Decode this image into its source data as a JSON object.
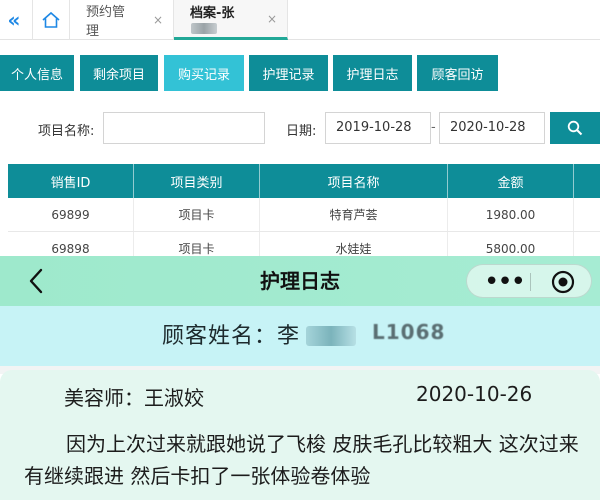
{
  "topbar": {
    "tabs": [
      {
        "label": "预约管理",
        "close": "×"
      },
      {
        "label": "档案-张",
        "close": "×"
      }
    ],
    "icons": {
      "back": "double-chevron-left-icon",
      "home": "home-icon"
    }
  },
  "buttons": [
    "个人信息",
    "剩余项目",
    "购买记录",
    "护理记录",
    "护理日志",
    "顾客回访"
  ],
  "active_button": "购买记录",
  "search": {
    "project_name_label": "项目名称:",
    "project_name_value": "",
    "date_label": "日期:",
    "date_from": "2019-10-28",
    "date_separator": "-",
    "date_to": "2020-10-28",
    "search_icon": "magnifier-icon"
  },
  "table": {
    "headers": [
      "销售ID",
      "项目类别",
      "项目名称",
      "金额"
    ],
    "rows": [
      [
        "69899",
        "项目卡",
        "特育芦荟",
        "1980.00"
      ],
      [
        "69898",
        "项目卡",
        "水娃娃",
        "5800.00"
      ]
    ]
  },
  "mobile": {
    "title": "护理日志",
    "customer_label": "顾客姓名：李",
    "customer_code": "L1068",
    "beautician_label": "美容师：王淑姣",
    "date": "2020-10-26",
    "content": "因为上次过来就跟她说了飞梭 皮肤毛孔比较粗大 这次过来有继续跟进 然后卡扣了一张体验卷体验",
    "capsule_dots": "•••"
  },
  "colors": {
    "teal": "#0e8d98",
    "active_button": "#33c2d6",
    "mobile_header": "#a6ecd3",
    "name_banner": "#c7f3f6",
    "card": "#e4f7f0",
    "chevron_blue": "#1e88e5"
  }
}
